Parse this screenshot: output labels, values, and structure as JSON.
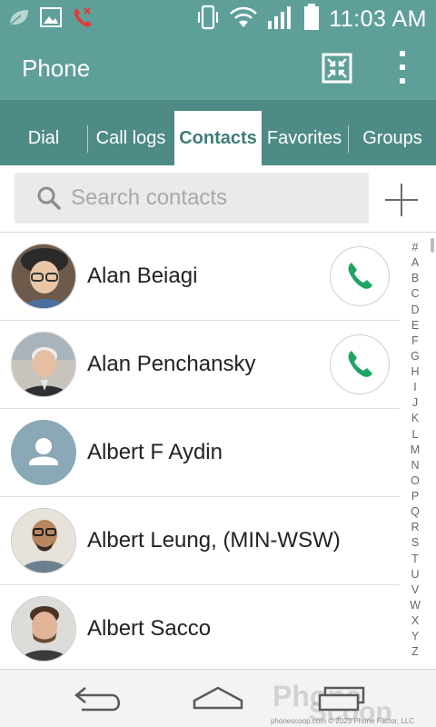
{
  "status_bar": {
    "time": "11:03 AM",
    "left_icons": [
      "leaf-icon",
      "image-icon",
      "missed-call-icon"
    ],
    "right_icons": [
      "vibrate-icon",
      "wifi-icon",
      "signal-icon",
      "battery-icon"
    ]
  },
  "app_bar": {
    "title": "Phone",
    "fit_icon": "fit-screen-icon",
    "menu_icon": "overflow-menu-icon"
  },
  "tabs": [
    {
      "label": "Dial",
      "active": false
    },
    {
      "label": "Call logs",
      "active": false
    },
    {
      "label": "Contacts",
      "active": true
    },
    {
      "label": "Favorites",
      "active": false
    },
    {
      "label": "Groups",
      "active": false
    }
  ],
  "search": {
    "placeholder": "Search contacts",
    "value": "",
    "add_icon": "plus-icon"
  },
  "contacts": [
    {
      "name": "Alan Beiagi",
      "has_call_button": true,
      "avatar": "photo"
    },
    {
      "name": "Alan Penchansky",
      "has_call_button": true,
      "avatar": "photo"
    },
    {
      "name": "Albert F Aydin",
      "has_call_button": false,
      "avatar": "placeholder"
    },
    {
      "name": "Albert Leung, (MIN-WSW)",
      "has_call_button": false,
      "avatar": "photo"
    },
    {
      "name": "Albert Sacco",
      "has_call_button": false,
      "avatar": "photo"
    }
  ],
  "alphabet": [
    "#",
    "A",
    "B",
    "C",
    "D",
    "E",
    "F",
    "G",
    "H",
    "I",
    "J",
    "K",
    "L",
    "M",
    "N",
    "O",
    "P",
    "Q",
    "R",
    "S",
    "T",
    "U",
    "V",
    "W",
    "X",
    "Y",
    "Z"
  ],
  "nav_bar": {
    "back_icon": "back-icon",
    "home_icon": "home-icon",
    "recents_icon": "recent-apps-icon"
  },
  "watermark": {
    "logo_text": "Phone Scoop",
    "credit": "phonescoop.com  © 2023 Phone Factor, LLC"
  },
  "colors": {
    "toolbar": "#5f9f9a",
    "tabs": "#4e8a86",
    "active_tab_text": "#3f7d78",
    "call_green": "#1fa463",
    "placeholder_avatar": "#8aa8b6"
  }
}
